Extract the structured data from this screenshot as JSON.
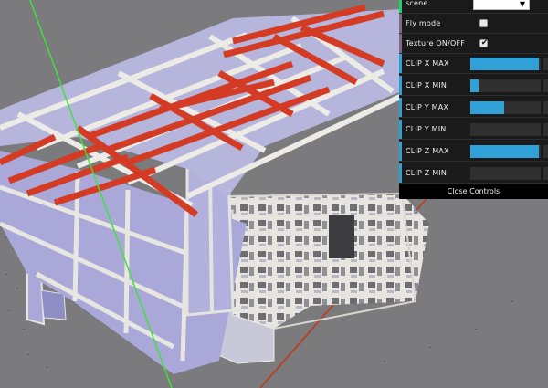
{
  "gui": {
    "scene": {
      "label": "scene",
      "value": ""
    },
    "fly_mode": {
      "label": "Fly mode",
      "checked": false
    },
    "texture": {
      "label": "Texture ON/OFF",
      "checked": true,
      "check_glyph": "✔"
    },
    "clip": [
      {
        "label": "CLIP X MAX",
        "level": 0.97
      },
      {
        "label": "CLIP X MIN",
        "level": 0.12
      },
      {
        "label": "CLIP Y MAX",
        "level": 0.48
      },
      {
        "label": "CLIP Y MIN",
        "level": 0.0
      },
      {
        "label": "CLIP Z MAX",
        "level": 0.98
      },
      {
        "label": "CLIP Z MIN",
        "level": 0.0
      }
    ],
    "close_label": "Close Controls",
    "select_arrow": "▼",
    "colors": {
      "slider_fill": "#2fa1d6",
      "accent_folder": "#1ed36f",
      "accent_boolean": "#806787",
      "accent_number": "#2fa1d6"
    }
  },
  "scene": {
    "background": "#7b7b7d",
    "wall_color": "#a9a8d8",
    "beam_color": "#d43b24",
    "axis_green": "#3fe23a",
    "axis_red": "#b0442e"
  }
}
